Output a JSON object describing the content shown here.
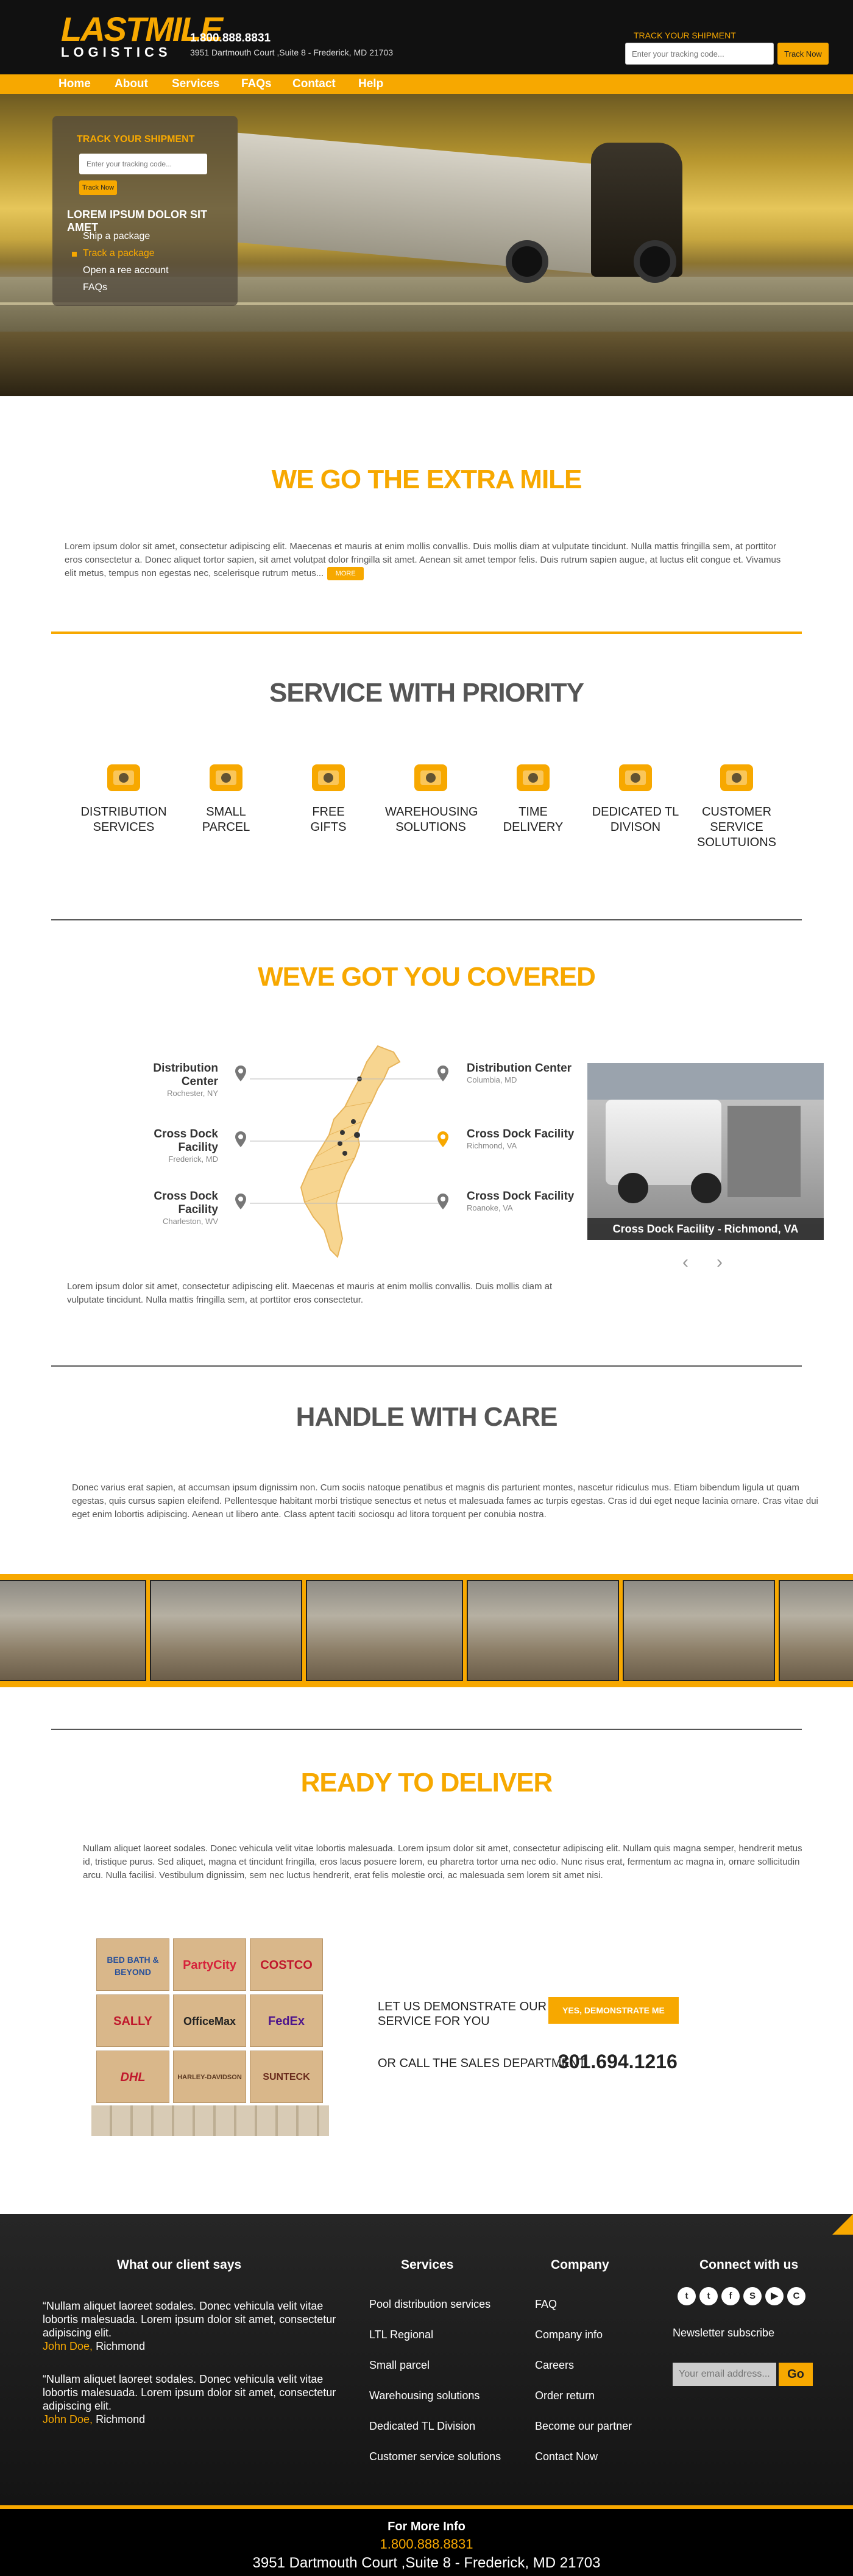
{
  "header": {
    "logo_top": "LASTMILE",
    "logo_bottom": "LOGISTICS",
    "phone": "1.800.888.8831",
    "address": "3951 Dartmouth Court ,Suite 8 - Frederick, MD 21703",
    "track_label": "TRACK YOUR SHIPMENT",
    "track_placeholder": "Enter your tracking code...",
    "track_button": "Track Now"
  },
  "nav": [
    "Home",
    "About",
    "Services",
    "FAQs",
    "Contact",
    "Help"
  ],
  "hero": {
    "track_title": "TRACK YOUR SHIPMENT",
    "track_placeholder": "Enter your tracking code...",
    "track_button": "Track Now",
    "heading": "LOREM IPSUM DOLOR SIT AMET",
    "links": [
      "Ship a package",
      "Track a package",
      "Open a ree account",
      "FAQs"
    ]
  },
  "extra_mile": {
    "title": "WE GO THE EXTRA MILE",
    "text": "Lorem ipsum dolor sit amet, consectetur adipiscing elit. Maecenas et mauris at enim mollis convallis. Duis mollis diam at vulputate tincidunt. Nulla mattis fringilla sem, at porttitor eros consectetur a. Donec aliquet tortor sapien, sit amet volutpat dolor fringilla sit amet. Aenean sit amet tempor felis. Duis rutrum sapien augue, at luctus elit congue et. Vivamus elit metus, tempus non egestas nec, scelerisque rutrum metus...",
    "more": "MORE"
  },
  "priority": {
    "title": "SERVICE WITH PRIORITY",
    "items": [
      {
        "l1": "DISTRIBUTION",
        "l2": "SERVICES",
        "l3": "",
        "icon": "truck-icon"
      },
      {
        "l1": "SMALL",
        "l2": "PARCEL",
        "l3": "",
        "icon": "parcel-icon"
      },
      {
        "l1": "FREE",
        "l2": "GIFTS",
        "l3": "",
        "icon": "gift-icon"
      },
      {
        "l1": "WAREHOUSING",
        "l2": "SOLUTIONS",
        "l3": "",
        "icon": "hand-truck-icon"
      },
      {
        "l1": "TIME",
        "l2": "DELIVERY",
        "l3": "",
        "icon": "clock-icon"
      },
      {
        "l1": "DEDICATED TL",
        "l2": "DIVISON",
        "l3": "",
        "icon": "magnifier-icon"
      },
      {
        "l1": "CUSTOMER",
        "l2": "SERVICE",
        "l3": "SOLUTUIONS",
        "icon": "headset-icon"
      }
    ]
  },
  "covered": {
    "title": "WEVE GOT YOU COVERED",
    "left": [
      {
        "name": "Distribution Center",
        "place": "Rochester, NY"
      },
      {
        "name": "Cross Dock Facility",
        "place": "Frederick, MD"
      },
      {
        "name": "Cross Dock Facility",
        "place": "Charleston, WV"
      }
    ],
    "right": [
      {
        "name": "Distribution Center",
        "place": "Columbia, MD"
      },
      {
        "name": "Cross Dock Facility",
        "place": "Richmond, VA"
      },
      {
        "name": "Cross Dock Facility",
        "place": "Roanoke, VA"
      }
    ],
    "photo_caption": "Cross Dock Facility - Richmond, VA",
    "text": "Lorem ipsum dolor sit amet, consectetur adipiscing elit. Maecenas et mauris at enim mollis convallis. Duis mollis diam at vulputate tincidunt. Nulla mattis fringilla sem, at porttitor eros consectetur."
  },
  "care": {
    "title": "HANDLE WITH CARE",
    "text": "Donec varius erat sapien, at accumsan ipsum dignissim non. Cum sociis natoque penatibus et magnis dis parturient montes, nascetur ridiculus mus. Etiam bibendum ligula ut quam egestas, quis cursus sapien eleifend. Pellentesque habitant morbi tristique senectus et netus et malesuada fames ac turpis egestas. Cras id dui eget neque lacinia ornare. Cras vitae dui eget enim lobortis adipiscing. Aenean ut libero ante. Class aptent taciti sociosqu ad litora torquent per conubia nostra."
  },
  "deliver": {
    "title": "READY TO DELIVER",
    "text": "Nullam aliquet laoreet sodales. Donec vehicula velit vitae lobortis malesuada. Lorem ipsum dolor sit amet, consectetur adipiscing elit. Nullam quis magna semper, hendrerit metus id, tristique purus. Sed aliquet, magna et tincidunt fringilla, eros lacus posuere lorem, eu pharetra tortor urna nec odio. Nunc risus erat, fermentum ac magna in, ornare sollicitudin arcu. Nulla facilisi. Vestibulum dignissim, sem nec luctus hendrerit, erat felis molestie orci, ac malesuada sem lorem sit amet nisi.",
    "boxes": [
      "BED BATH & BEYOND",
      "PartyCity",
      "COSTCO",
      "SALLY",
      "OfficeMax",
      "FedEx",
      "DHL",
      "HARLEY-DAVIDSON",
      "SUNTECK"
    ],
    "demo_line1": "LET US DEMONSTRATE OUR GREAT",
    "demo_line2": "SERVICE FOR YOU",
    "demo_button": "YES, DEMONSTRATE ME",
    "call_label": "OR CALL THE SALES DEPARTMENT",
    "call_number": "301.694.1216"
  },
  "footer": {
    "clients_title": "What our client says",
    "quotes": [
      {
        "text": "“Nullam aliquet laoreet sodales. Donec vehicula velit vitae lobortis malesuada. Lorem ipsum dolor sit amet, consectetur adipiscing elit.",
        "name": "John Doe,",
        "city": " Richmond"
      },
      {
        "text": "“Nullam aliquet laoreet sodales. Donec vehicula velit vitae lobortis malesuada. Lorem ipsum dolor sit amet, consectetur adipiscing elit.",
        "name": "John Doe,",
        "city": " Richmond"
      }
    ],
    "services_title": "Services",
    "services": [
      "Pool distribution services",
      "LTL Regional",
      "Small parcel",
      "Warehousing solutions",
      "Dedicated TL Division",
      "Customer service solutions"
    ],
    "company_title": "Company",
    "company": [
      "FAQ",
      "Company info",
      "Careers",
      "Order return",
      "Become our partner",
      "Contact Now"
    ],
    "connect_title": "Connect with us",
    "social": [
      {
        "icon": "twitter-icon",
        "glyph": "t"
      },
      {
        "icon": "tumblr-icon",
        "glyph": "t"
      },
      {
        "icon": "facebook-icon",
        "glyph": "f"
      },
      {
        "icon": "skype-icon",
        "glyph": "S"
      },
      {
        "icon": "youtube-icon",
        "glyph": "▶"
      },
      {
        "icon": "share-icon",
        "glyph": "C"
      }
    ],
    "newsletter_label": "Newsletter subscribe",
    "newsletter_placeholder": "Your email address...",
    "newsletter_button": "Go"
  },
  "bottom": {
    "label": "For More Info",
    "phone": "1.800.888.8831",
    "address": "3951 Dartmouth Court ,Suite 8 - Frederick, MD 21703"
  },
  "colors": {
    "accent": "#f7a800",
    "dark": "#111111"
  }
}
